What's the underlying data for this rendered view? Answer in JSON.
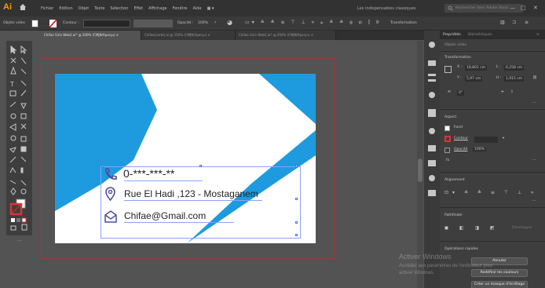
{
  "menubar": {
    "logo": "Ai",
    "menus": [
      "Fichier",
      "Edition",
      "Objet",
      "Texte",
      "Sélection",
      "Effet",
      "Affichage",
      "Fenêtre",
      "Aide"
    ],
    "workspace": "Les indispensables classiques",
    "search_placeholder": "Rechercher dans Adobe Stock"
  },
  "controlbar": {
    "selection_label": "Objets vides",
    "stroke_label": "Contour :",
    "opacity_label": "Opacité :",
    "opacity_value": "100%",
    "transform_label": "Transformation"
  },
  "tabs": [
    {
      "label": "Chifae Sirin Web2.ai* @ 200% (CMJN/Aperçu)",
      "active": true
    },
    {
      "label": "Chifae(carte).ai @ 150% (CMJN/Aperçu)",
      "active": false
    },
    {
      "label": "Chifae Sirin Web2.ai* @ 200% (CMJN/Aperçu)",
      "active": false
    }
  ],
  "card": {
    "phone": "0-***-***-**",
    "address": "Rue El Hadi ,123 - Mostaganem",
    "email": "Chifae@Gmail.com",
    "color_bg": "#1d9bde",
    "color_white": "#ffffff"
  },
  "panel": {
    "tabs": [
      "Propriétés",
      "Bibliothèques"
    ],
    "subtitle": "Objets vides",
    "transform_title": "Transformation",
    "x_label": "X :",
    "x_value": "18,801 cm",
    "y_label": "Y :",
    "y_value": "5,97 cm",
    "w_label": "L :",
    "w_value": "6,258 cm",
    "h_label": "H :",
    "h_value": "1,915 cm",
    "angle_value": "0°",
    "appearance_title": "Aspect",
    "fill_label": "Fond",
    "stroke_label": "Contour",
    "opacity_label": "Opacité",
    "opacity_value": "100%",
    "align_title": "Alignement",
    "pathfinder_title": "Pathfinder",
    "pathfinder_extend": "Développer",
    "quick_actions_title": "Opérations rapides",
    "btn_recolor": "Annuler",
    "btn_colors": "Redéfinir les couleurs",
    "btn_art": "Créer un masque d'écrêtage"
  },
  "watermark": {
    "line1": "Activer Windows",
    "line2": "Accédez aux paramètres de l'ordinateur pour",
    "line3": "activer Windows."
  }
}
